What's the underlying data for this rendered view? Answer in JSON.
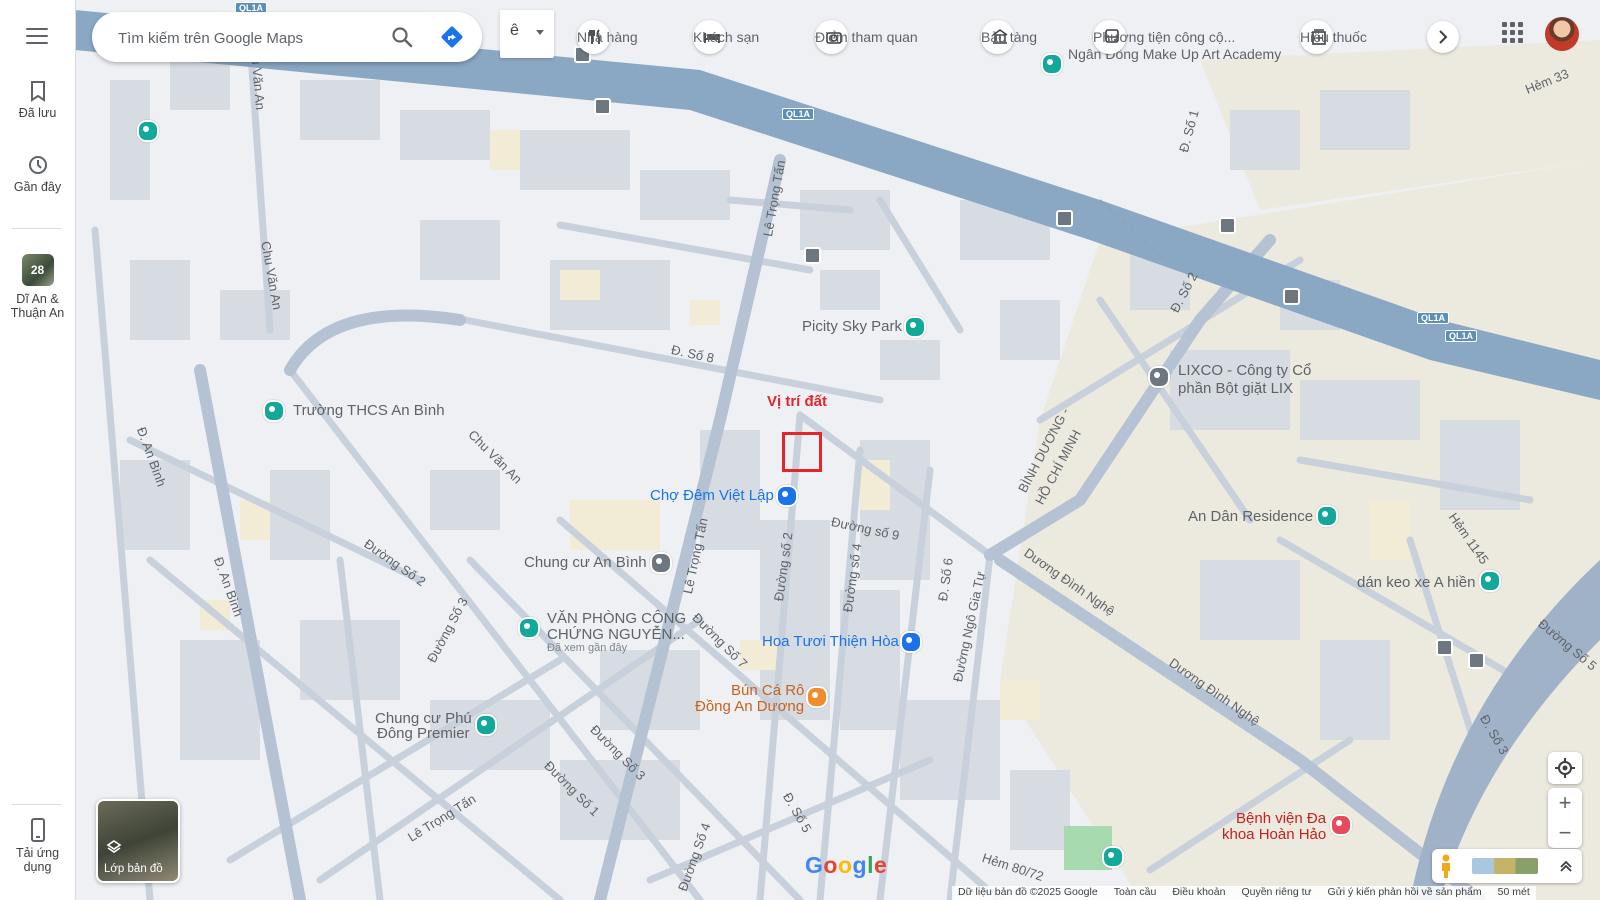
{
  "rail": {
    "saved_label": "Đã lưu",
    "recent_label": "Gần đây",
    "recent_place_badge": "28",
    "recent_place_label_1": "Dĩ An &",
    "recent_place_label_2": "Thuận An",
    "get_app_label_1": "Tải ứng",
    "get_app_label_2": "dụng"
  },
  "search": {
    "placeholder": "Tìm kiếm trên Google Maps",
    "lang": "ê"
  },
  "chips": [
    {
      "label": "Nhà hàng",
      "icon": "fork-knife-icon"
    },
    {
      "label": "Khách sạn",
      "icon": "bed-icon"
    },
    {
      "label": "Điểm tham quan",
      "icon": "camera-icon"
    },
    {
      "label": "Bảo tàng",
      "icon": "museum-icon"
    },
    {
      "label": "Phương tiện công cộ...",
      "icon": "bus-icon"
    },
    {
      "label": "Hiệu thuốc",
      "icon": "pharmacy-icon"
    }
  ],
  "map": {
    "target_label": "Vị trí đất",
    "pois": {
      "art": "Ngân Đồng Make Up Art Academy",
      "picity": "Picity Sky Park",
      "lixco_1": "LIXCO - Công ty Cổ",
      "lixco_2": "phần Bột giặt LIX",
      "school": "Trường THCS An Bình",
      "market": "Chợ Đêm Việt Lập",
      "apartment": "Chung cư An Bình",
      "office_1": "VĂN PHÒNG CÔNG",
      "office_2": "CHỨNG NGUYỄN...",
      "office_sub": "Đã xem gần đây",
      "flower": "Hoa Tươi Thiện Hòa",
      "food_1": "Bún Cá Rô",
      "food_2": "Đồng An Dương",
      "phudong_1": "Chung cư Phú",
      "phudong_2": "Đông Premier",
      "residence": "An Dân Residence",
      "glue": "dán keo xe A hiền",
      "hospital_1": "Bệnh viện Đa",
      "hospital_2": "khoa Hoàn Hảo"
    },
    "streets": {
      "le_trong_tan_n": "Lê Trọng Tấn",
      "le_trong_tan_s": "Lê Trọng Tấn",
      "le_trong_tan_sw": "Lê Trọng Tấn",
      "d_so_8": "Đ. Số 8",
      "duong_so_9": "Đường số 9",
      "duong_so_2a": "Đường số 2",
      "duong_so_4": "Đường số 4",
      "d_so_6": "Đ. Số 6",
      "duong_ngo_gia_tu": "Đường Ngô Gia Tự",
      "duong_dinh_nghe_a": "Dương Đình Nghệ",
      "duong_dinh_nghe_b": "Dương Đình Nghệ",
      "binh_duong_1": "BÌNH DƯƠNG -",
      "binh_duong_2": "HỒ CHÍ MINH",
      "chu_van_an_a": "Chu Văn An",
      "chu_van_an_b": "Chu Văn An",
      "chu_van_an_c": "Chu Văn An",
      "d_an_binh_a": "Đ. An Bình",
      "d_an_binh_b": "Đ. An Bình",
      "duong_so_2b": "Đường Số 2",
      "duong_so_3a": "Đường Số 3",
      "duong_so_3b": "Đường Số 3",
      "duong_so_7": "Đường Số 7",
      "duong_so_1": "Đường Số 1",
      "duong_so_4b": "Đường Số 4",
      "d_so_5": "Đ. Số 5",
      "hem_80_72": "Hẻm 80/72",
      "d_so_1": "Đ. Số 1",
      "d_so_2": "Đ. Số 2",
      "hem_33": "Hẻm 33",
      "hem_1145": "Hẻm 1145",
      "duong_so_5": "Đường Số 5",
      "d_so_3": "Đ. Số 3",
      "ql1a": "QL1A"
    }
  },
  "controls": {
    "layers_label": "Lớp bản đồ",
    "zoom_in": "+",
    "zoom_out": "−",
    "scale": "50 mét"
  },
  "footer": {
    "data": "Dữ liệu bản đồ ©2025 Google",
    "global": "Toàn cầu",
    "terms": "Điều khoản",
    "privacy": "Quyền riêng tư",
    "feedback": "Gửi ý kiến phản hồi về sản phẩm"
  },
  "colors": {
    "target": "#e3262b",
    "road_major": "#8aa7c4",
    "road_minor": "#c5ced9",
    "building": "#d6dbe2",
    "yellow_block": "#f2ecd6"
  }
}
